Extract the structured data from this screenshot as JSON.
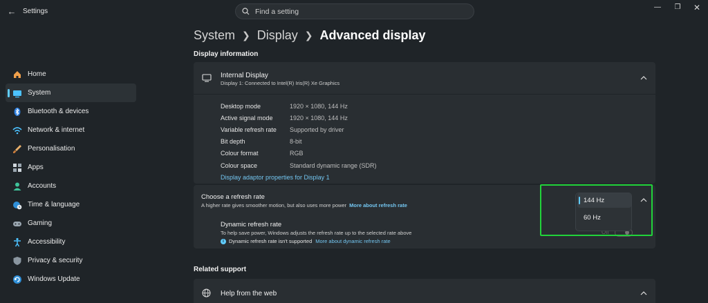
{
  "window": {
    "title": "Settings",
    "controls": [
      "minimize",
      "maximize",
      "close"
    ]
  },
  "search": {
    "placeholder": "Find a setting"
  },
  "sidebar": {
    "items": [
      {
        "label": "Home",
        "icon": "home-icon"
      },
      {
        "label": "System",
        "icon": "system-icon",
        "active": true
      },
      {
        "label": "Bluetooth & devices",
        "icon": "bluetooth-icon"
      },
      {
        "label": "Network & internet",
        "icon": "wifi-icon"
      },
      {
        "label": "Personalisation",
        "icon": "brush-icon"
      },
      {
        "label": "Apps",
        "icon": "apps-icon"
      },
      {
        "label": "Accounts",
        "icon": "account-icon"
      },
      {
        "label": "Time & language",
        "icon": "globe-clock-icon"
      },
      {
        "label": "Gaming",
        "icon": "gamepad-icon"
      },
      {
        "label": "Accessibility",
        "icon": "accessibility-icon"
      },
      {
        "label": "Privacy & security",
        "icon": "shield-icon"
      },
      {
        "label": "Windows Update",
        "icon": "update-icon"
      }
    ]
  },
  "breadcrumb": {
    "level1": "System",
    "level2": "Display",
    "current": "Advanced display"
  },
  "display_info": {
    "section_title": "Display information",
    "card_title": "Internal Display",
    "card_subtitle": "Display 1: Connected to Intel(R) Iris(R) Xe Graphics",
    "rows": [
      {
        "key": "Desktop mode",
        "value": "1920 × 1080, 144 Hz"
      },
      {
        "key": "Active signal mode",
        "value": "1920 × 1080, 144 Hz"
      },
      {
        "key": "Variable refresh rate",
        "value": "Supported by driver"
      },
      {
        "key": "Bit depth",
        "value": "8-bit"
      },
      {
        "key": "Colour format",
        "value": "RGB"
      },
      {
        "key": "Colour space",
        "value": "Standard dynamic range (SDR)"
      }
    ],
    "adapter_link": "Display adaptor properties for Display 1"
  },
  "refresh_rate": {
    "title": "Choose a refresh rate",
    "subtitle": "A higher rate gives smoother motion, but also uses more power",
    "more_link": "More about refresh rate",
    "options": [
      "144 Hz",
      "60 Hz"
    ],
    "selected": "144 Hz",
    "highlight_color": "#21d43a"
  },
  "dynamic_refresh": {
    "title": "Dynamic refresh rate",
    "subtitle": "To help save power, Windows adjusts the refresh rate up to the selected rate above",
    "note": "Dynamic refresh rate isn't supported",
    "more_link": "More about dynamic refresh rate",
    "toggle_label": "Off",
    "toggle_on": false
  },
  "related_support": {
    "section_title": "Related support",
    "help_title": "Help from the web"
  },
  "colors": {
    "accent": "#60cdff",
    "background": "#1f2428",
    "card": "#292e32",
    "link": "#74c7f2"
  }
}
